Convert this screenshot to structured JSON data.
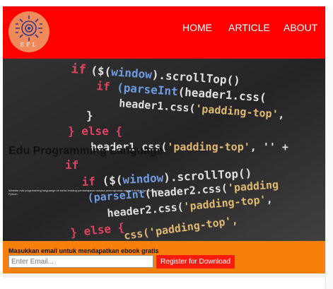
{
  "nav": {
    "logo_text": "EPL",
    "links": [
      "HOME",
      "ARTICLE",
      "ABOUT"
    ],
    "background": "#ff0000"
  },
  "hero": {
    "title": "Edu Programming Language",
    "description": "Website edu programming languange ini berisi tentang pembelajaran bahasa pemrograman seperti Kotlin, JavaScript dan Python."
  },
  "signup": {
    "label": "Masukkan email untuk mendapatkan ebook gratis",
    "email_placeholder": "Enter Email...",
    "button_label": "Register for Download",
    "background": "#f77f0c",
    "button_color": "#ff1a0d"
  }
}
